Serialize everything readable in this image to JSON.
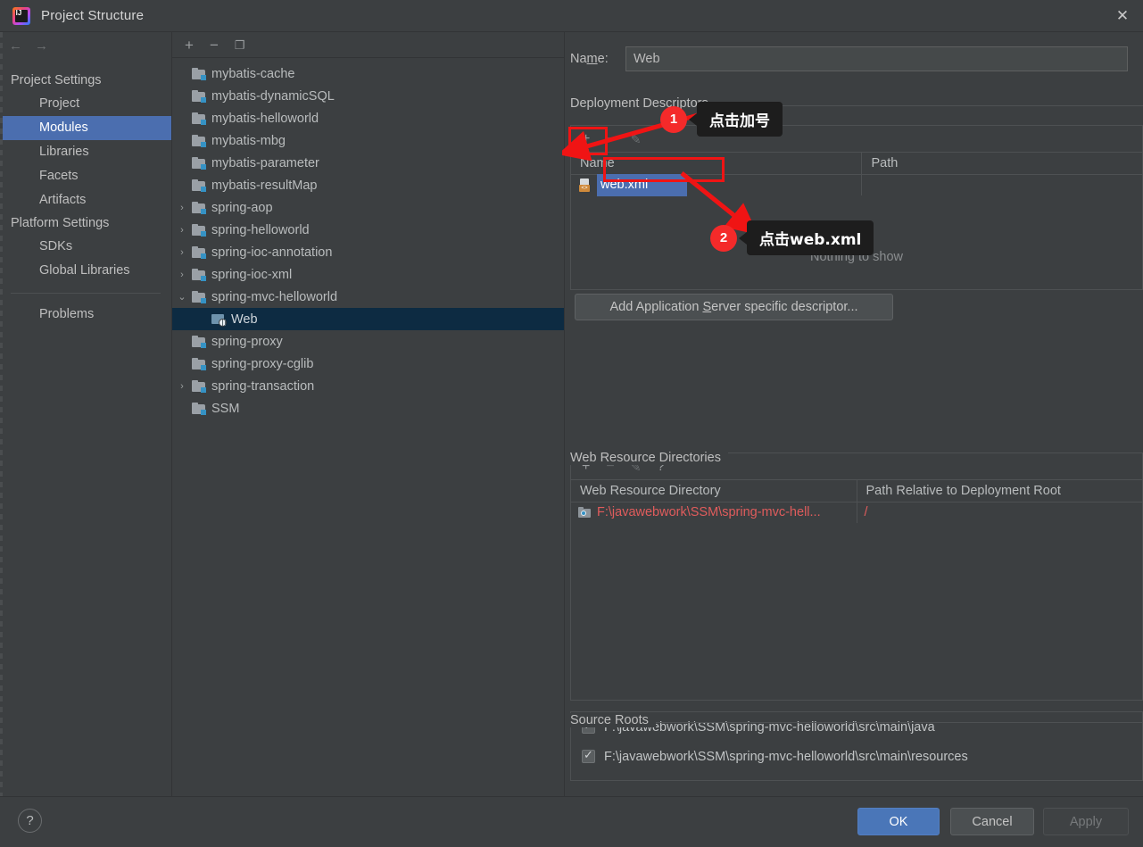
{
  "window": {
    "title": "Project Structure",
    "logo_text": "IJ",
    "close_icon": "✕",
    "accent_blue": "#4b6eaf",
    "background": "#3c3f41",
    "annotation_red": "#f01414"
  },
  "nav": {
    "back_icon": "←",
    "forward_icon": "→",
    "groups": [
      {
        "label": "Project Settings",
        "items": [
          {
            "label": "Project",
            "selected": false
          },
          {
            "label": "Modules",
            "selected": true
          },
          {
            "label": "Libraries",
            "selected": false
          },
          {
            "label": "Facets",
            "selected": false
          },
          {
            "label": "Artifacts",
            "selected": false
          }
        ]
      },
      {
        "label": "Platform Settings",
        "items": [
          {
            "label": "SDKs",
            "selected": false
          },
          {
            "label": "Global Libraries",
            "selected": false
          }
        ]
      }
    ],
    "problems_label": "Problems"
  },
  "tree": {
    "toolbar": {
      "add_icon": "+",
      "remove_icon": "−",
      "copy_icon": "❐"
    },
    "rows": [
      {
        "label": "mybatis-cache",
        "twisty": "",
        "icon": "module-icon",
        "selected": false
      },
      {
        "label": "mybatis-dynamicSQL",
        "twisty": "",
        "icon": "module-icon",
        "selected": false
      },
      {
        "label": "mybatis-helloworld",
        "twisty": "",
        "icon": "module-icon",
        "selected": false
      },
      {
        "label": "mybatis-mbg",
        "twisty": "",
        "icon": "module-icon",
        "selected": false
      },
      {
        "label": "mybatis-parameter",
        "twisty": "",
        "icon": "module-icon",
        "selected": false
      },
      {
        "label": "mybatis-resultMap",
        "twisty": "",
        "icon": "module-icon",
        "selected": false
      },
      {
        "label": "spring-aop",
        "twisty": "›",
        "icon": "module-icon",
        "selected": false
      },
      {
        "label": "spring-helloworld",
        "twisty": "›",
        "icon": "module-icon",
        "selected": false
      },
      {
        "label": "spring-ioc-annotation",
        "twisty": "›",
        "icon": "module-icon",
        "selected": false
      },
      {
        "label": "spring-ioc-xml",
        "twisty": "›",
        "icon": "module-icon",
        "selected": false
      },
      {
        "label": "spring-mvc-helloworld",
        "twisty": "⌄",
        "icon": "module-icon",
        "selected": false
      },
      {
        "label": "Web",
        "twisty": "",
        "icon": "web-facet-icon",
        "selected": true,
        "child": true
      },
      {
        "label": "spring-proxy",
        "twisty": "",
        "icon": "module-icon",
        "selected": false
      },
      {
        "label": "spring-proxy-cglib",
        "twisty": "",
        "icon": "module-icon",
        "selected": false
      },
      {
        "label": "spring-transaction",
        "twisty": "›",
        "icon": "module-icon",
        "selected": false
      },
      {
        "label": "SSM",
        "twisty": "",
        "icon": "module-icon",
        "selected": false
      }
    ]
  },
  "detail": {
    "name_label_pre": "Na",
    "name_label_mnemonic": "m",
    "name_label_post": "e:",
    "name_value": "Web",
    "name_placeholder": "",
    "deployment": {
      "section_title": "Deployment Descriptors",
      "toolbar": {
        "add_icon": "+",
        "remove_icon": "−",
        "edit_icon": "✎"
      },
      "columns": [
        "Name",
        "Path"
      ],
      "rows": [
        {
          "name": "web.xml",
          "path": "",
          "selected": true
        }
      ],
      "empty_text": "Nothing to show"
    },
    "add_app_button": {
      "pre": "Add Application ",
      "mnemonic": "S",
      "post": "erver specific descriptor..."
    },
    "web_resources": {
      "section_title": "Web Resource Directories",
      "toolbar": {
        "add_icon": "+",
        "remove_icon": "−",
        "edit_icon": "✎",
        "help_icon": "?"
      },
      "columns": [
        "Web Resource Directory",
        "Path Relative to Deployment Root"
      ],
      "rows": [
        {
          "directory": "F:\\javawebwork\\SSM\\spring-mvc-hell...",
          "path": "/"
        }
      ]
    },
    "source_roots": {
      "section_title": "Source Roots",
      "items": [
        {
          "path": "F:\\javawebwork\\SSM\\spring-mvc-helloworld\\src\\main\\java",
          "checked": true
        },
        {
          "path": "F:\\javawebwork\\SSM\\spring-mvc-helloworld\\src\\main\\resources",
          "checked": true
        }
      ]
    }
  },
  "footer": {
    "help_icon": "?",
    "ok_label": "OK",
    "cancel_label": "Cancel",
    "apply_label": "Apply"
  },
  "annotations": [
    {
      "number": "1",
      "text": "点击加号"
    },
    {
      "number": "2",
      "text": "点击web.xml"
    }
  ]
}
